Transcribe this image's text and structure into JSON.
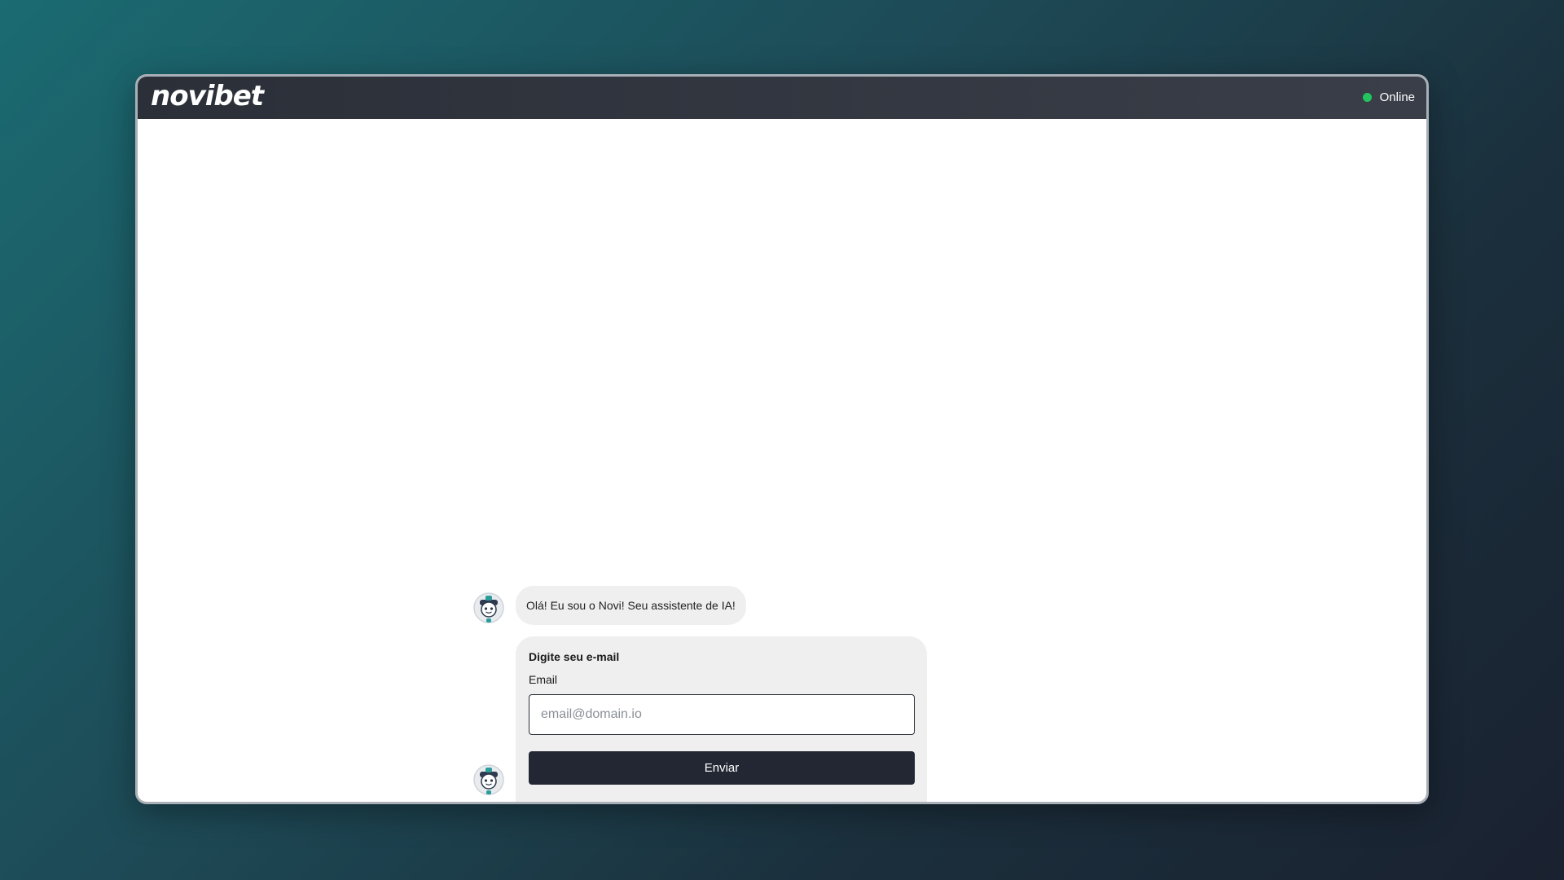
{
  "header": {
    "logo_text": "novibet",
    "status_text": "Online",
    "status_color": "#22c55e"
  },
  "chat": {
    "messages": [
      {
        "sender": "bot",
        "text": "Olá! Eu sou o Novi! Seu assistente de IA!"
      }
    ],
    "form": {
      "title": "Digite seu e-mail",
      "email_label": "Email",
      "email_placeholder": "email@domain.io",
      "email_value": "",
      "submit_label": "Enviar"
    }
  },
  "icons": {
    "bot_avatar": "robot-avatar-icon",
    "status": "status-dot-icon"
  }
}
